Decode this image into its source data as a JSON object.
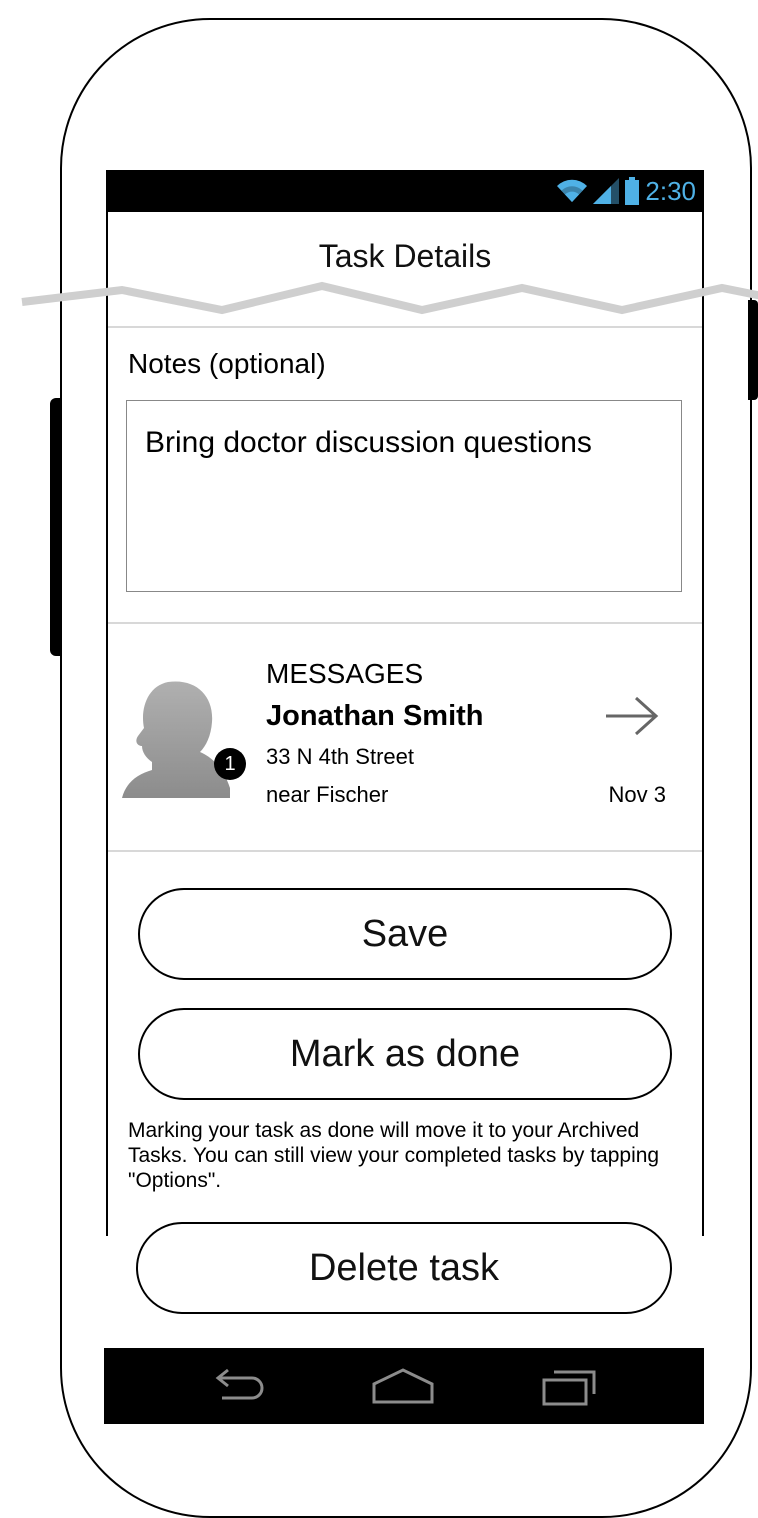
{
  "status_bar": {
    "time": "2:30",
    "icons": [
      "wifi-icon",
      "signal-icon",
      "battery-icon"
    ],
    "accent_color": "#4fb1e6"
  },
  "header": {
    "title": "Task Details"
  },
  "notes": {
    "label": "Notes (optional)",
    "value": "Bring doctor discussion questions"
  },
  "message_card": {
    "category": "MESSAGES",
    "name": "Jonathan Smith",
    "address_line1": "33 N 4th Street",
    "address_line2": "near Fischer",
    "date": "Nov 3",
    "badge_count": "1",
    "arrow_icon": "arrow-right-icon"
  },
  "actions": {
    "save_label": "Save",
    "mark_done_label": "Mark as done",
    "info_text": "Marking your task as done will move it to your Archived Tasks. You can still view your completed tasks by tapping \"Options\".",
    "delete_label": "Delete task"
  },
  "nav_bar": {
    "icons": [
      "back-icon",
      "home-icon",
      "recent-apps-icon"
    ]
  }
}
